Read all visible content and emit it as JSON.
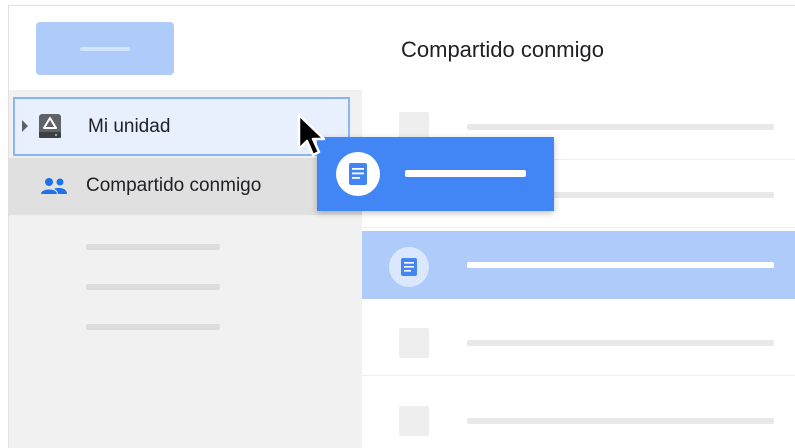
{
  "header": {
    "title": "Compartido conmigo",
    "new_button_icon": "placeholder-bar"
  },
  "sidebar": {
    "items": [
      {
        "label": "Mi unidad",
        "icon": "google-drive-icon",
        "expander": "caret-right-icon",
        "state": "drop-target-hover"
      },
      {
        "label": "Compartido conmigo",
        "icon": "people-icon",
        "state": "selected"
      }
    ],
    "placeholder_items": 3
  },
  "file_list": {
    "rows": [
      {
        "icon": "file-thumbnail",
        "state": "normal"
      },
      {
        "icon": "file-thumbnail",
        "state": "dragging-source"
      },
      {
        "icon": "google-docs-icon",
        "state": "selected"
      },
      {
        "icon": "file-thumbnail",
        "state": "normal"
      },
      {
        "icon": "file-thumbnail",
        "state": "normal"
      }
    ]
  },
  "drag_ghost": {
    "icon": "google-docs-icon"
  },
  "colors": {
    "accent": "#4285f4",
    "selection": "#aecbfa",
    "drop_target": "#e8f0fe",
    "drop_target_border": "#8ab4f8",
    "sidebar_bg": "#f1f1f1"
  }
}
